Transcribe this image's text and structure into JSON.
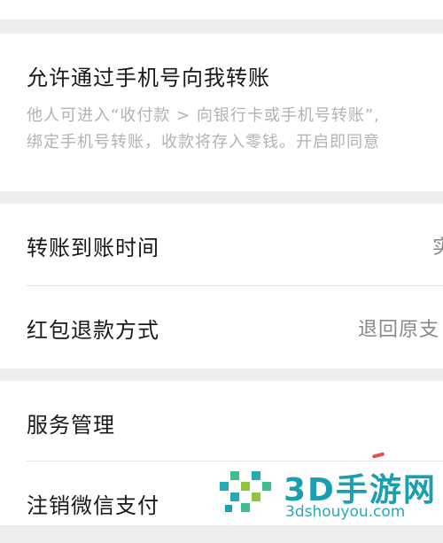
{
  "top_fragment": "",
  "allow_transfer": {
    "title": "允许通过手机号向我转账",
    "desc_line1": "他人可进入“收付款 > 向银行卡或手机号转账”,",
    "desc_line2": "绑定手机号转账，收款将存入零钱。开启即同意"
  },
  "transfer_time": {
    "label": "转账到账时间",
    "value": "实"
  },
  "red_packet_refund": {
    "label": "红包退款方式",
    "value": "退回原支"
  },
  "service_manage": {
    "label": "服务管理"
  },
  "cancel_pay": {
    "label": "注销微信支付"
  },
  "watermark": {
    "title": "3D手游网",
    "url": "3dshouyou.com",
    "colors": {
      "main": "#1a9fb0",
      "accent": "#2aa9b4"
    }
  }
}
